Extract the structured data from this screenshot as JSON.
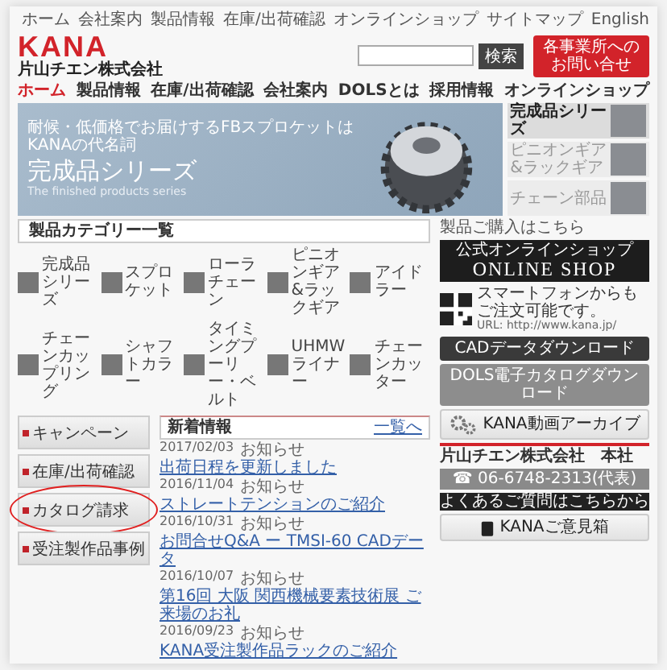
{
  "top_links": [
    "ホーム",
    "会社案内",
    "製品情報",
    "在庫/出荷確認",
    "オンラインショップ",
    "サイトマップ",
    "English"
  ],
  "logo": {
    "brand": "KANA",
    "company": "片山チエン株式会社"
  },
  "search": {
    "button": "検索"
  },
  "contact_button": [
    "各事業所への",
    "お問い合せ"
  ],
  "nav": [
    {
      "label": "ホーム",
      "selected": true
    },
    {
      "label": "製品情報",
      "selected": false
    },
    {
      "label": "在庫/出荷確認",
      "selected": false
    },
    {
      "label": "会社案内",
      "selected": false
    },
    {
      "label": "DOLSとは",
      "selected": false
    },
    {
      "label": "採用情報",
      "selected": false
    },
    {
      "label": "オンラインショップ",
      "selected": false
    }
  ],
  "hero": {
    "tagline": [
      "耐候・低価格でお届けするFBスプロケットは",
      "KANAの代名詞"
    ],
    "title": "完成品シリーズ",
    "subtitle": "The finished products series"
  },
  "hero_tabs": [
    {
      "label": "完成品シリーズ",
      "selected": true
    },
    {
      "label": "ピニオンギア&ラックギア",
      "selected": false
    },
    {
      "label": "チェーン部品",
      "selected": false
    }
  ],
  "categories": {
    "title": "製品カテゴリー一覧",
    "items": [
      "完成品シリーズ",
      "スプロケット",
      "ローラチェーン",
      "ピニオンギア&ラックギア",
      "アイドラー",
      "チェーンカップリング",
      "シャフトカラー",
      "タイミングプーリー・ベルト",
      "UHMWライナー",
      "チェーンカッター"
    ]
  },
  "side_menu": [
    {
      "label": "キャンペーン",
      "circled": false
    },
    {
      "label": "在庫/出荷確認",
      "circled": false
    },
    {
      "label": "カタログ請求",
      "circled": true
    },
    {
      "label": "受注製作品事例",
      "circled": false
    }
  ],
  "news": {
    "title": "新着情報",
    "more": "一覧へ",
    "items": [
      {
        "date": "2017/02/03",
        "tag": "お知らせ",
        "title": "出荷日程を更新しました"
      },
      {
        "date": "2016/11/04",
        "tag": "お知らせ",
        "title": "ストレートテンションのご紹介"
      },
      {
        "date": "2016/10/31",
        "tag": "お知らせ",
        "title": "お問合せQ&A ー TMSI-60 CADデータ"
      },
      {
        "date": "2016/10/07",
        "tag": "お知らせ",
        "title": "第16回 大阪 関西機械要素技術展 ご来場のお礼"
      },
      {
        "date": "2016/09/23",
        "tag": "お知らせ",
        "title": "KANA受注製作品ラックのご紹介"
      }
    ]
  },
  "right": {
    "heading": "製品ご購入はこちら",
    "shop_top": "公式オンラインショップ",
    "shop_name": "ONLINE SHOP",
    "qr_text": "スマートフォンからもご注文可能です。",
    "url": "URL: http://www.kana.jp/",
    "cad": "CADデータダウンロード",
    "dols": "DOLS電子カタログダウンロード",
    "video": "KANA動画アーカイブ",
    "hq": "片山チエン株式会社　本社",
    "phone": "☎ 06-6748-2313(代表)",
    "faq": "よくあるご質問はこちらから",
    "opinion": "KANAご意見箱"
  }
}
